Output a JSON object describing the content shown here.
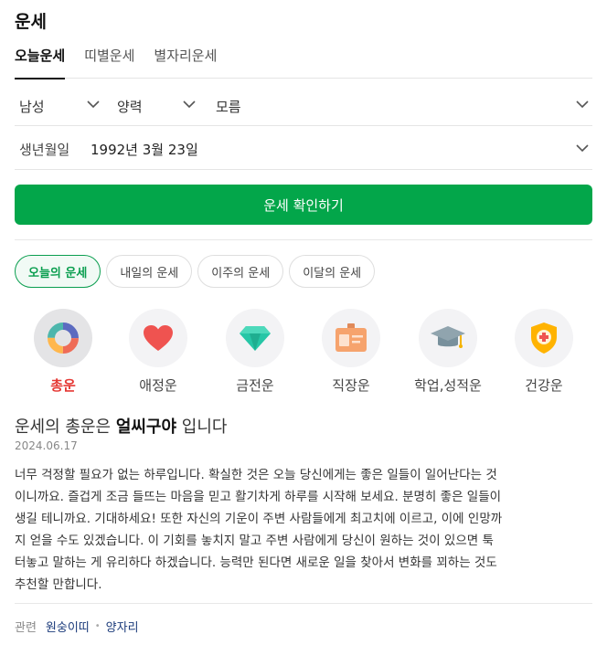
{
  "page": {
    "title": "운세"
  },
  "tabs": [
    {
      "label": "오늘운세",
      "active": true
    },
    {
      "label": "띠별운세",
      "active": false
    },
    {
      "label": "별자리운세",
      "active": false
    }
  ],
  "selectors": {
    "gender": "남성",
    "calendar": "양력",
    "time": "모름"
  },
  "birth": {
    "label": "생년월일",
    "value": "1992년 3월 23일"
  },
  "confirm_label": "운세 확인하기",
  "period_chips": [
    {
      "label": "오늘의 운세",
      "active": true
    },
    {
      "label": "내일의 운세",
      "active": false
    },
    {
      "label": "이주의 운세",
      "active": false
    },
    {
      "label": "이달의 운세",
      "active": false
    }
  ],
  "categories": [
    {
      "label": "총운",
      "icon": "donut-chart-icon",
      "active": true
    },
    {
      "label": "애정운",
      "icon": "heart-icon",
      "active": false
    },
    {
      "label": "금전운",
      "icon": "diamond-icon",
      "active": false
    },
    {
      "label": "직장운",
      "icon": "id-badge-icon",
      "active": false
    },
    {
      "label": "학업,성적운",
      "icon": "graduation-cap-icon",
      "active": false
    },
    {
      "label": "건강운",
      "icon": "health-shield-icon",
      "active": false
    }
  ],
  "result": {
    "prefix": "운세의 총운은 ",
    "keyword": "얼씨구야",
    "suffix": " 입니다",
    "date": "2024.06.17",
    "lines": [
      "너무 걱정할 필요가 없는 하루입니다. 확실한 것은 오늘 당신에게는 좋은 일들이 일어난다는 것",
      "이니까요. 즐겁게 조금 들뜨는 마음을 믿고 활기차게 하루를 시작해 보세요. 분명히 좋은 일들이",
      "생길 테니까요. 기대하세요! 또한 자신의 기운이 주변 사람들에게 최고치에 이르고, 이에 인망까",
      "지 얻을 수도 있겠습니다. 이 기회를 놓치지 말고 주변 사람에게 당신이 원하는 것이 있으면 툭",
      "터놓고 말하는 게 유리하다 하겠습니다. 능력만 된다면 새로운 일을 찾아서 변화를 꾀하는 것도",
      "추천할 만합니다."
    ]
  },
  "related": {
    "label": "관련",
    "links": [
      "원숭이띠",
      "양자리"
    ]
  },
  "colors": {
    "primary_green": "#03a64a",
    "active_category": "#e53935",
    "link": "#1a3a7a"
  }
}
